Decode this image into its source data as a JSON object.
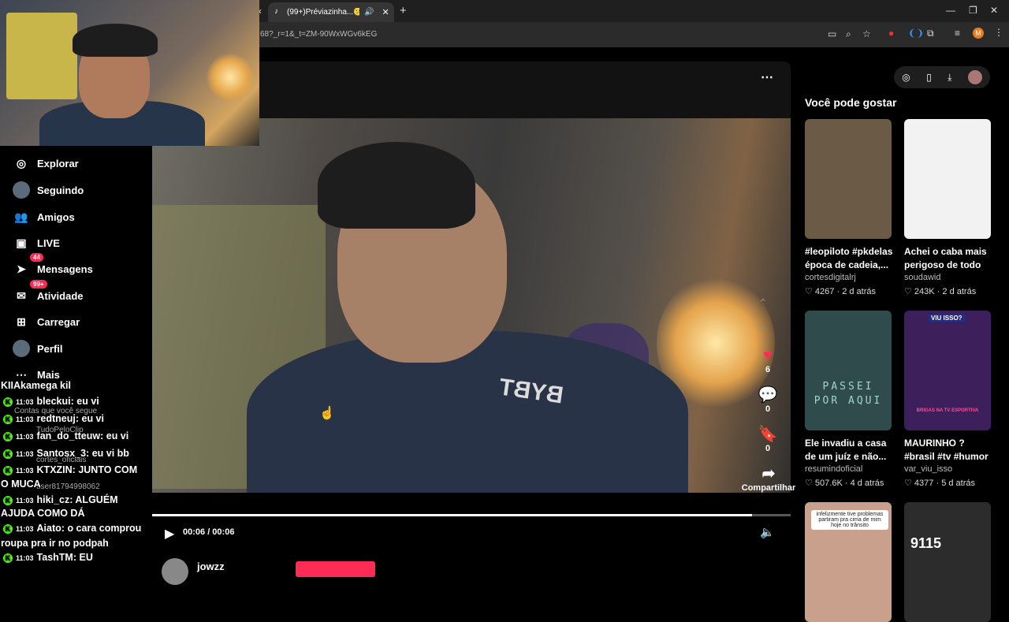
{
  "browser": {
    "tab_title": "(99+)Préviazinha...😕😮",
    "url": "68?_r=1&_t=ZM-90WxWGv6kEG",
    "profile_initial": "M"
  },
  "sidebar": {
    "items": [
      {
        "label": "Explorar",
        "icon": "compass-icon"
      },
      {
        "label": "Seguindo",
        "icon": "following-avatar-icon"
      },
      {
        "label": "Amigos",
        "icon": "friends-icon"
      },
      {
        "label": "LIVE",
        "icon": "live-icon"
      },
      {
        "label": "Mensagens",
        "icon": "messages-icon",
        "badge": "44"
      },
      {
        "label": "Atividade",
        "icon": "activity-icon",
        "badge": "99+"
      },
      {
        "label": "Carregar",
        "icon": "upload-icon"
      },
      {
        "label": "Perfil",
        "icon": "profile-avatar-icon"
      },
      {
        "label": "Mais",
        "icon": "more-icon"
      }
    ],
    "following_label": "Contas que você segue",
    "following_accounts": [
      "TudoPeloClip",
      "cortes_oficiais",
      "user81794998062"
    ]
  },
  "chat": {
    "messages": [
      {
        "text": "KIIAkamega kil",
        "time": "",
        "user": ""
      },
      {
        "time": "11:03",
        "user": "bleckui:",
        "text": "eu vi"
      },
      {
        "time": "11:03",
        "user": "redtneuj:",
        "text": "eu vi"
      },
      {
        "time": "11:03",
        "user": "fan_do_tteuw:",
        "text": "eu vi"
      },
      {
        "time": "11:03",
        "user": "Santosx_3:",
        "text": "eu vi bb"
      },
      {
        "time": "11:03",
        "user": "KTXZIN:",
        "text": "JUNTO COM"
      },
      {
        "time": "",
        "user": "",
        "text": "O MUCA"
      },
      {
        "time": "11:03",
        "user": "hiki_cz:",
        "text": "ALGUÉM"
      },
      {
        "time": "",
        "user": "",
        "text": "AJUDA COMO DÁ"
      },
      {
        "time": "11:03",
        "user": "Aiato:",
        "text": "o cara comprou"
      },
      {
        "time": "",
        "user": "",
        "text": "roupa pra ir no podpah"
      },
      {
        "time": "11:03",
        "user": "TashTM:",
        "text": "EU"
      }
    ]
  },
  "video": {
    "time_display": "00:06 / 00:06",
    "progress_fraction": 0.94,
    "shirt_text": "BYBT",
    "likes": "6",
    "comments": "0",
    "saves": "0",
    "share_label": "Compartilhar",
    "author": "jowzz"
  },
  "recommendations": {
    "heading": "Você pode gostar",
    "cards": [
      {
        "title": "#leopiloto #pkdelas época de cadeia,...",
        "author": "cortesdigitalrj",
        "likes": "4267",
        "age": "2 d atrás",
        "thumb": "#6b5a46"
      },
      {
        "title": "Achei o caba mais perigoso de todo o...",
        "author": "soudawid",
        "likes": "243K",
        "age": "2 d atrás",
        "thumb": "#f2f2f2"
      },
      {
        "title": "Ele invadiu a casa de um juíz e não...",
        "author": "resumindoficial",
        "likes": "507.6K",
        "age": "4 d atrás",
        "thumb": "#2f4b4c"
      },
      {
        "title": "MAURINHO ? #brasil #tv #humor #futeb...",
        "author": "var_viu_isso",
        "likes": "4377",
        "age": "5 d atrás",
        "thumb": "#3d1f5c"
      },
      {
        "title": "",
        "author": "",
        "likes": "",
        "age": "",
        "thumb": "#c9a08c",
        "caption": "infelizmente tive problemas partiram pra cima de mim hoje no trânsito"
      },
      {
        "title": "",
        "author": "",
        "likes": "",
        "age": "",
        "thumb": "#2c2c2c",
        "overlay": "9115"
      }
    ],
    "poster_text": "PASSEI POR AQUI",
    "viu_isso": "VIU ISSO?",
    "brigas": "BRIGAS NA TV ESPORTIVA"
  }
}
